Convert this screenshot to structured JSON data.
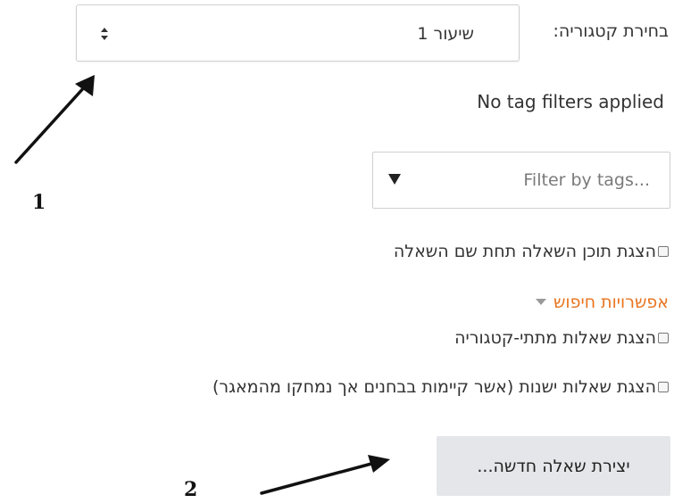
{
  "category": {
    "label": "בחירת קטגוריה:",
    "selected": "שיעור 1"
  },
  "tags": {
    "status": "No tag filters applied",
    "placeholder": "Filter by tags..."
  },
  "options": {
    "show_question_text": "הצגת תוכן השאלה תחת שם השאלה",
    "search_options_label": "אפשרויות חיפוש",
    "show_subcategories": "הצגת שאלות מתתי-קטגוריה",
    "show_old_questions": "הצגת שאלות ישנות (אשר קיימות בבחנים אך נמחקו מהמאגר)"
  },
  "actions": {
    "create_new_question": "יצירת שאלה חדשה..."
  },
  "annotations": {
    "marker_1": "1",
    "marker_2": "2"
  },
  "colors": {
    "link": "#e8741e",
    "button_bg": "#e4e6e9",
    "border": "#cfcfcf"
  }
}
